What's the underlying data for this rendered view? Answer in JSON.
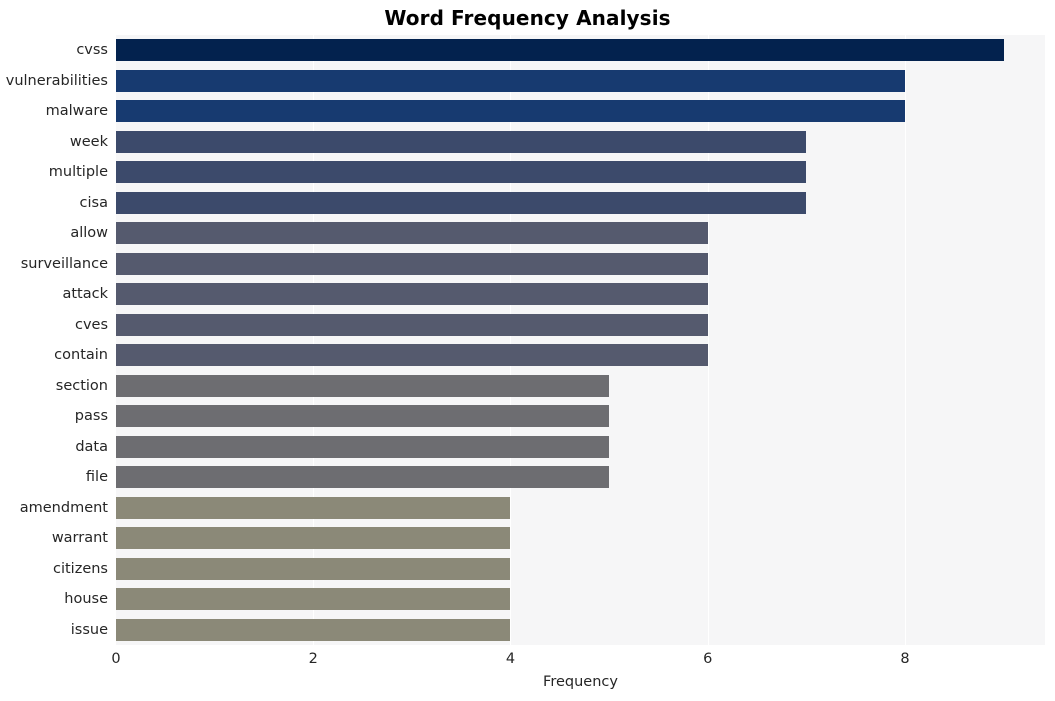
{
  "chart_data": {
    "type": "bar",
    "orientation": "horizontal",
    "title": "Word Frequency Analysis",
    "xlabel": "Frequency",
    "ylabel": "",
    "xlim": [
      0,
      9.42
    ],
    "xticks": [
      0,
      2,
      4,
      6,
      8
    ],
    "xtick_labels": [
      "0",
      "2",
      "4",
      "6",
      "8"
    ],
    "grid": "vertical",
    "legend": "none",
    "background": "#f6f6f7",
    "categories": [
      "cvss",
      "vulnerabilities",
      "malware",
      "week",
      "multiple",
      "cisa",
      "allow",
      "surveillance",
      "attack",
      "cves",
      "contain",
      "section",
      "pass",
      "data",
      "file",
      "amendment",
      "warrant",
      "citizens",
      "house",
      "issue"
    ],
    "values": [
      9,
      8,
      8,
      7,
      7,
      7,
      6,
      6,
      6,
      6,
      6,
      5,
      5,
      5,
      5,
      4,
      4,
      4,
      4,
      4
    ],
    "bar_colors": [
      "#03224e",
      "#173a70",
      "#173a70",
      "#3c4a6b",
      "#3c4a6b",
      "#3c4a6b",
      "#555a6e",
      "#555a6e",
      "#555a6e",
      "#555a6e",
      "#555a6e",
      "#6d6d71",
      "#6d6d71",
      "#6d6d71",
      "#6d6d71",
      "#8b8978",
      "#8b8978",
      "#8b8978",
      "#8b8978",
      "#8b8978"
    ]
  }
}
